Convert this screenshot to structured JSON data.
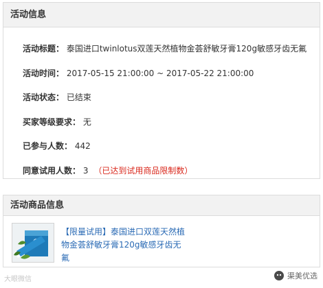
{
  "activity_info": {
    "header": "活动信息",
    "rows": [
      {
        "label": "活动标题：",
        "value": "泰国进口twinlotus双莲天然植物金荟舒敏牙膏120g敏感牙齿无氟"
      },
      {
        "label": "活动时间：",
        "value": "2017-05-15 21:00:00 ~ 2017-05-22 21:00:00"
      },
      {
        "label": "活动状态：",
        "value": "已结束"
      },
      {
        "label": "买家等级要求：",
        "value": "无"
      },
      {
        "label": "已参与人数：",
        "value": "442"
      },
      {
        "label": "同意试用人数：",
        "value": "3",
        "note": "（已达到试用商品限制数）"
      }
    ]
  },
  "goods_info": {
    "header": "活动商品信息",
    "title": "【限量试用】泰国进口双莲天然植物金荟舒敏牙膏120g敏感牙齿无氟"
  },
  "watermark": {
    "left": "大眼微信",
    "right": "渠美优选"
  },
  "colors": {
    "link": "#2b6bb5",
    "note": "#d9281c",
    "header_bg": "#f2f2f2",
    "border": "#dcdcdc"
  }
}
